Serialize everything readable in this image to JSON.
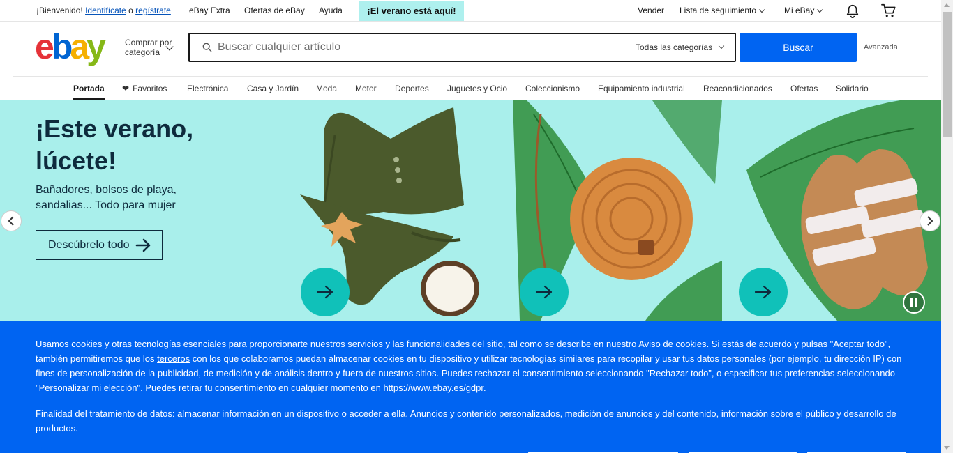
{
  "topbar": {
    "welcome": "¡Bienvenido!",
    "signin_link": "Identifícate",
    "or": "o",
    "register_link": "regístrate",
    "ebay_extra": "eBay Extra",
    "deals": "Ofertas de eBay",
    "help": "Ayuda",
    "summer_badge": "¡El verano está aquí!",
    "sell": "Vender",
    "watchlist": "Lista de seguimiento",
    "my_ebay": "Mi eBay"
  },
  "header": {
    "logo_letters": [
      "e",
      "b",
      "a",
      "y"
    ],
    "shop_by_line1": "Comprar por",
    "shop_by_line2": "categoría",
    "search_placeholder": "Buscar cualquier artículo",
    "category_select": "Todas las categorías",
    "search_button": "Buscar",
    "advanced": "Avanzada"
  },
  "nav": {
    "items": [
      {
        "label": "Portada",
        "active": true
      },
      {
        "label": "Favoritos"
      },
      {
        "label": "Electrónica"
      },
      {
        "label": "Casa y Jardín"
      },
      {
        "label": "Moda"
      },
      {
        "label": "Motor"
      },
      {
        "label": "Deportes"
      },
      {
        "label": "Juguetes y Ocio"
      },
      {
        "label": "Coleccionismo"
      },
      {
        "label": "Equipamiento industrial"
      },
      {
        "label": "Reacondicionados"
      },
      {
        "label": "Ofertas"
      },
      {
        "label": "Solidario"
      }
    ]
  },
  "hero": {
    "title_line1": "¡Este verano,",
    "title_line2": "lúcete!",
    "subtitle_line1": "Bañadores, bolsos de playa,",
    "subtitle_line2": "sandalias... Todo para mujer",
    "cta": "Descúbrelo todo",
    "background": "#a9efeb",
    "accent": "#10c1b9",
    "tiles": [
      "bikini",
      "rattan-bag",
      "sandals"
    ]
  },
  "cookie": {
    "p1_a": "Usamos cookies y otras tecnologías esenciales para proporcionarte nuestros servicios y las funcionalidades del sitio, tal como se describe en nuestro ",
    "p1_link1": "Aviso de cookies",
    "p1_b": ". Si estás de acuerdo y pulsas \"Aceptar todo\", también permitiremos que los ",
    "p1_link2": "terceros",
    "p1_c": " con los que colaboramos puedan almacenar cookies en tu dispositivo y utilizar tecnologías similares para recopilar y usar tus datos personales (por ejemplo, tu dirección IP) con fines de personalización de la publicidad, de medición y de análisis dentro y fuera de nuestros sitios. Puedes rechazar el consentimiento seleccionando \"Rechazar todo\", o especificar tus preferencias seleccionando \"Personalizar mi elección\". Puedes retirar tu consentimiento en cualquier momento en ",
    "p1_link3": "https://www.ebay.es/gdpr",
    "p1_d": ".",
    "p2": "Finalidad del tratamiento de datos: almacenar información en un dispositivo o acceder a ella. Anuncios y contenido personalizados, medición de anuncios y del contenido, información sobre el público y desarrollo de productos.",
    "background": "#0064f2"
  }
}
